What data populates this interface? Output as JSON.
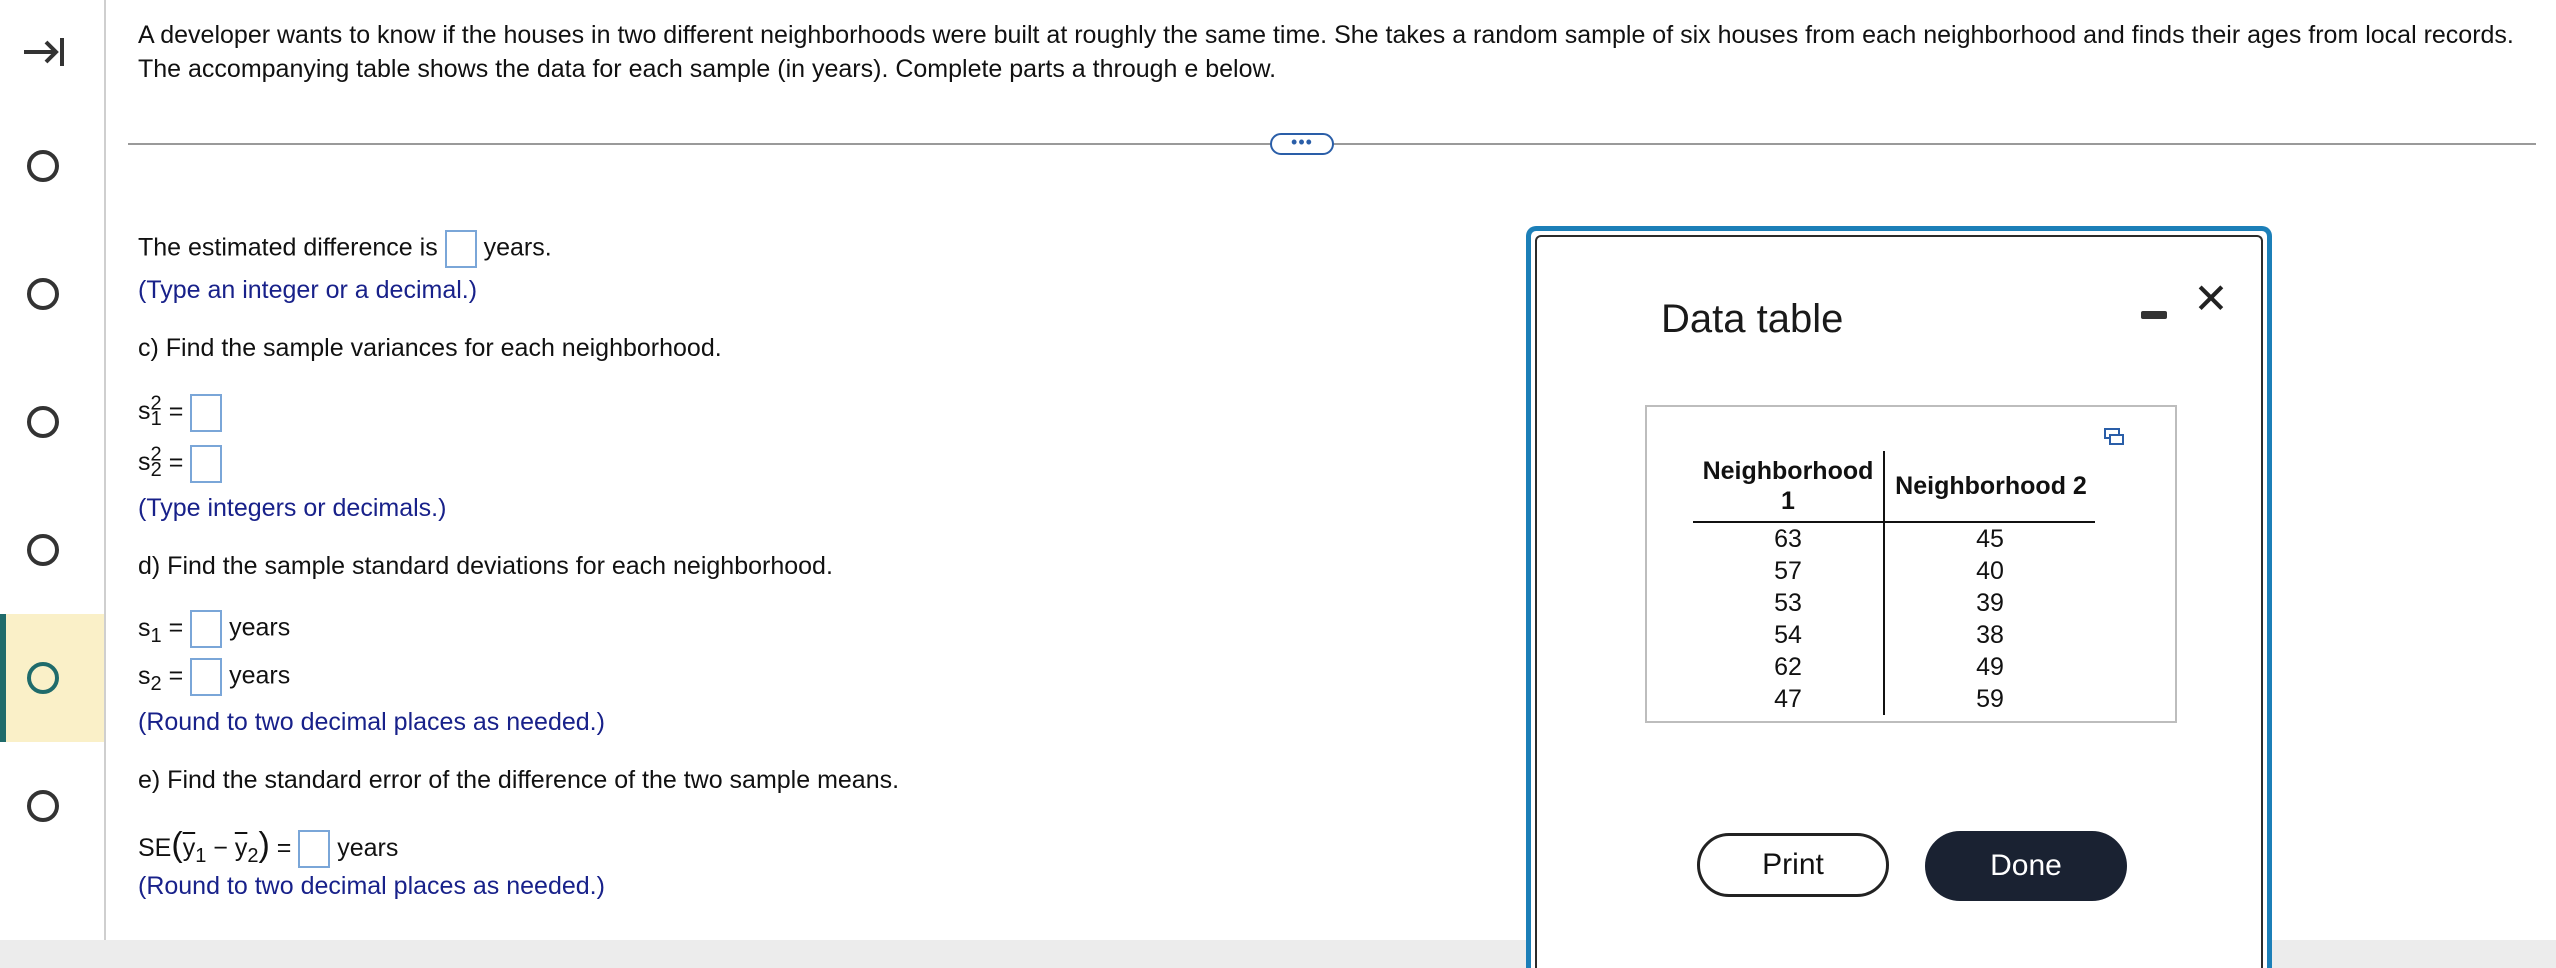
{
  "question": "A developer wants to know if the houses in two different neighborhoods were built at roughly the same time. She takes a random sample of six houses from each neighborhood and finds their ages from local records. The accompanying table shows the data for each sample (in years). Complete parts a through e below.",
  "divider_pill": "•••",
  "part_b": {
    "text_before": "The estimated difference is",
    "text_after": "years.",
    "hint": "(Type an integer or a decimal.)"
  },
  "part_c": {
    "prompt": "c) Find the sample variances for each neighborhood.",
    "s1_label": "s",
    "s1_sup": "2",
    "s1_sub": "1",
    "s2_label": "s",
    "s2_sup": "2",
    "s2_sub": "2",
    "equals": "=",
    "hint": "(Type integers or decimals.)"
  },
  "part_d": {
    "prompt": "d) Find the sample standard deviations for each neighborhood.",
    "s1_label": "s",
    "s1_sub": "1",
    "s2_label": "s",
    "s2_sub": "2",
    "equals": "=",
    "unit": "years",
    "hint": "(Round to two decimal places as needed.)"
  },
  "part_e": {
    "prompt": "e) Find the standard error of the difference of the two sample means.",
    "se_label": "SE",
    "y": "y",
    "minus": "−",
    "sub1": "1",
    "sub2": "2",
    "equals": "=",
    "unit": "years",
    "hint": "(Round to two decimal places as needed.)"
  },
  "dialog": {
    "title": "Data table",
    "close_glyph": "✕",
    "columns": [
      "Neighborhood 1",
      "Neighborhood 2"
    ],
    "col1_line1": "Neighborhood",
    "col1_line2": "1",
    "rows": [
      [
        "63",
        "45"
      ],
      [
        "57",
        "40"
      ],
      [
        "53",
        "39"
      ],
      [
        "54",
        "38"
      ],
      [
        "62",
        "49"
      ],
      [
        "47",
        "59"
      ]
    ],
    "print_label": "Print",
    "done_label": "Done"
  },
  "rail": {
    "expand_icon": "arrow-to-right-icon",
    "items": 6,
    "active_index": 4,
    "accent": "#1f6b6b",
    "active_bg": "#faf0c8"
  }
}
